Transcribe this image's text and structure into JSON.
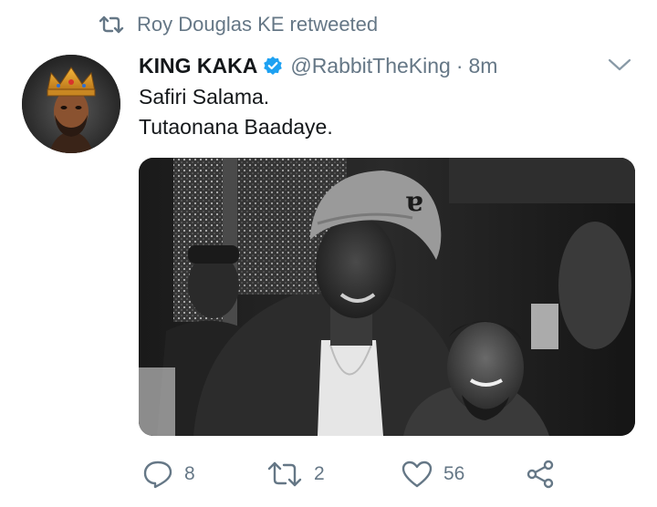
{
  "retweet_banner": {
    "text": "Roy Douglas KE retweeted",
    "icon": "retweet-icon"
  },
  "author": {
    "display_name": "KING KAKA",
    "verified": true,
    "verified_color": "#1da1f2",
    "handle": "@RabbitTheKing",
    "separator": "·",
    "time": "8m"
  },
  "tweet": {
    "lines": [
      "Safiri Salama.",
      "Tutaonana Baadaye."
    ]
  },
  "media": {
    "type": "photo",
    "style": "black-and-white"
  },
  "actions": {
    "reply": {
      "icon": "reply-icon",
      "count": "8"
    },
    "retweet": {
      "icon": "retweet-icon",
      "count": "2"
    },
    "like": {
      "icon": "heart-icon",
      "count": "56"
    },
    "share": {
      "icon": "share-icon"
    }
  },
  "colors": {
    "text_primary": "#14171a",
    "text_secondary": "#657786",
    "background": "#ffffff"
  }
}
